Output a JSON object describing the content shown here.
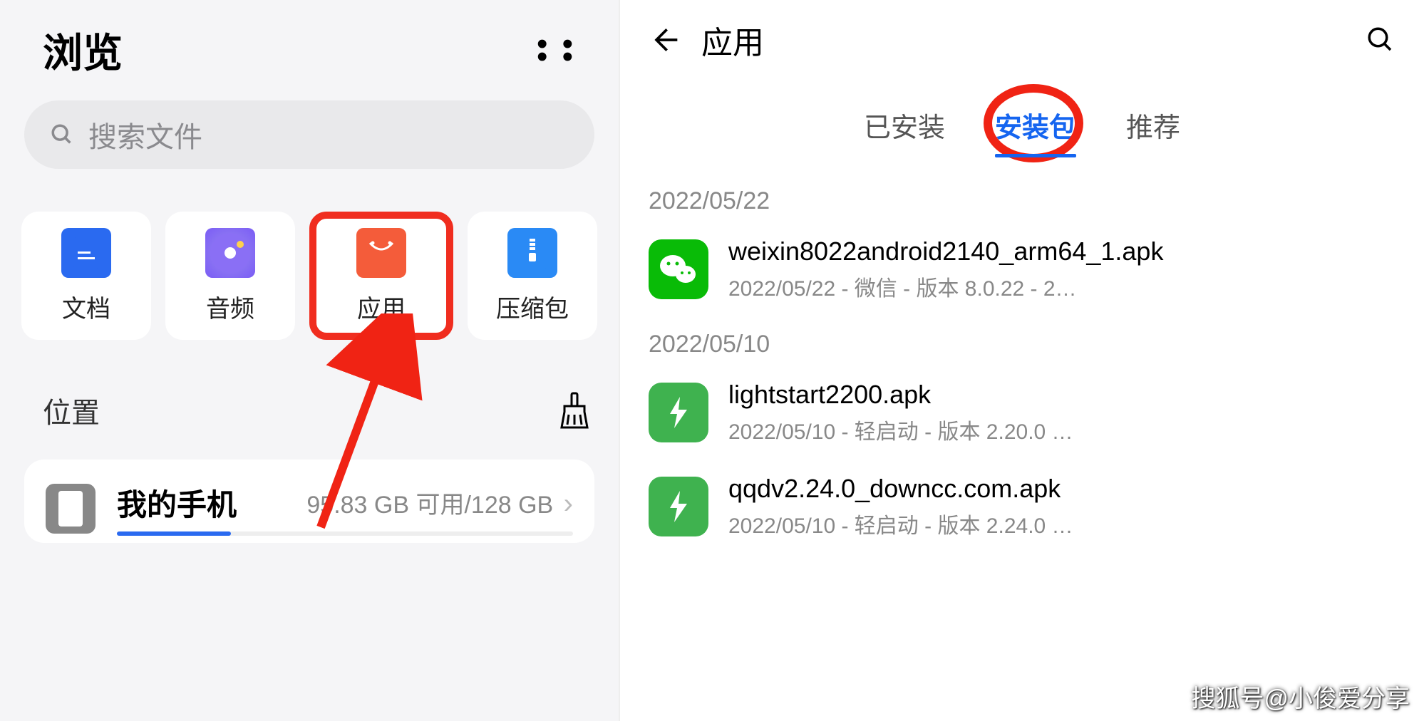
{
  "left": {
    "title": "浏览",
    "search_placeholder": "搜索文件",
    "categories": [
      {
        "label": "文档",
        "icon": "doc"
      },
      {
        "label": "音频",
        "icon": "audio"
      },
      {
        "label": "应用",
        "icon": "app",
        "highlighted": true
      },
      {
        "label": "压缩包",
        "icon": "zip"
      }
    ],
    "location_label": "位置",
    "storage": {
      "name": "我的手机",
      "info": "95.83 GB 可用/128 GB"
    }
  },
  "right": {
    "title": "应用",
    "tabs": [
      {
        "label": "已安装"
      },
      {
        "label": "安装包",
        "active": true
      },
      {
        "label": "推荐"
      }
    ],
    "groups": [
      {
        "date": "2022/05/22",
        "items": [
          {
            "icon": "wechat",
            "name": "weixin8022android2140_arm64_1.apk",
            "meta": "2022/05/22 - 微信 - 版本 8.0.22 - 2…"
          }
        ]
      },
      {
        "date": "2022/05/10",
        "items": [
          {
            "icon": "green",
            "name": "lightstart2200.apk",
            "meta": "2022/05/10 - 轻启动 - 版本 2.20.0 …"
          },
          {
            "icon": "green",
            "name": "qqdv2.24.0_downcc.com.apk",
            "meta": "2022/05/10 - 轻启动 - 版本 2.24.0 …"
          }
        ]
      }
    ]
  },
  "watermark": "搜狐号@小俊爱分享"
}
